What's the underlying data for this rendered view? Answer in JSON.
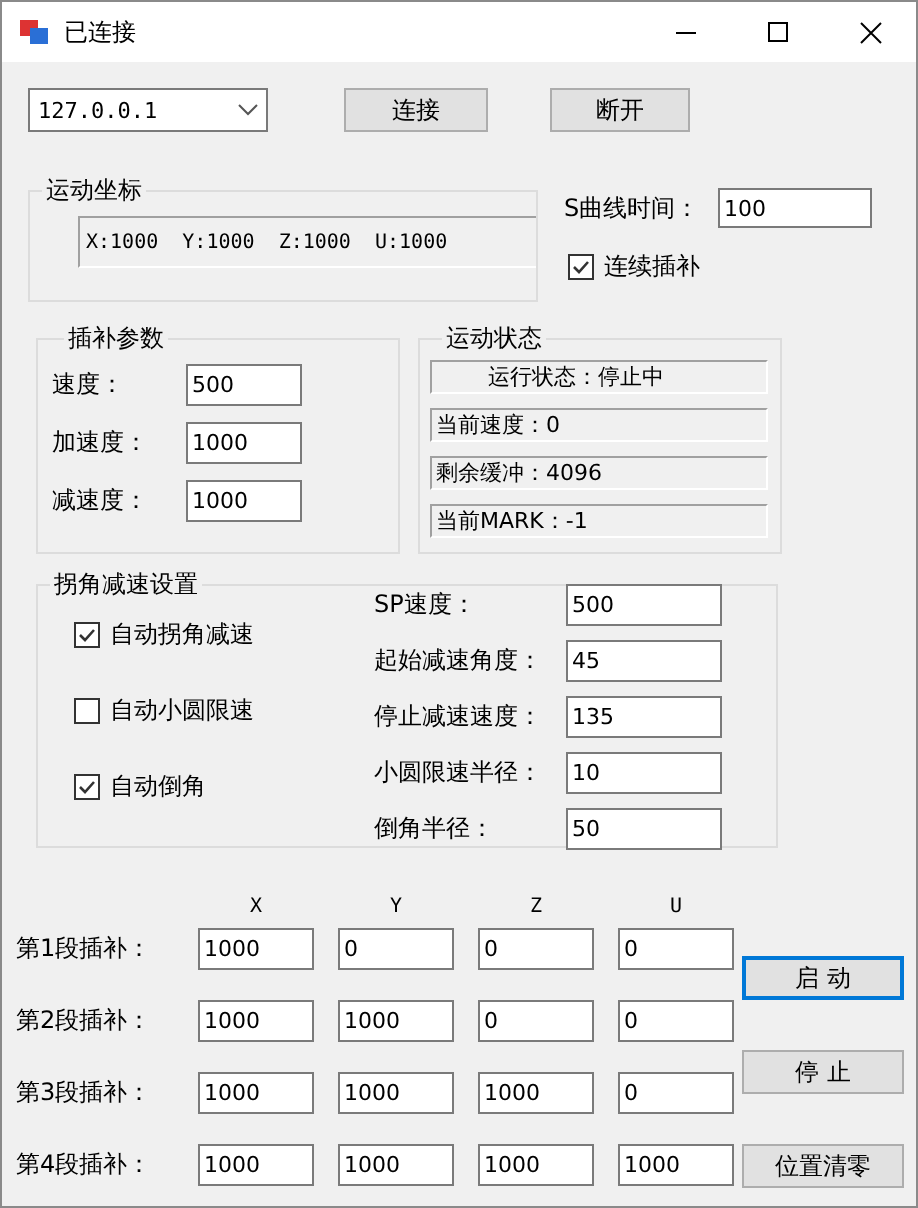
{
  "window": {
    "title": "已连接"
  },
  "connection": {
    "address": "127.0.0.1",
    "buttons": [
      "连接",
      "断开"
    ]
  },
  "coordinates": {
    "title": "运动坐标",
    "readout": "X:1000  Y:1000  Z:1000  U:1000"
  },
  "s_curve": {
    "label": "S曲线时间：",
    "value": "100"
  },
  "continuous": {
    "label": "连续插补",
    "checked": true
  },
  "interp_params": {
    "title": "插补参数",
    "fields": [
      {
        "label": "速度：",
        "value": "500"
      },
      {
        "label": "加速度：",
        "value": "1000"
      },
      {
        "label": "减速度：",
        "value": "1000"
      }
    ]
  },
  "motion_status": {
    "title": "运动状态",
    "lines": [
      "运行状态：停止中",
      "当前速度：0",
      "剩余缓冲：4096",
      "当前MARK：-1"
    ]
  },
  "corner": {
    "title": "拐角减速设置",
    "options": [
      {
        "label": "自动拐角减速",
        "checked": true
      },
      {
        "label": "自动小圆限速",
        "checked": false
      },
      {
        "label": "自动倒角",
        "checked": true
      }
    ],
    "fields": [
      {
        "label": "SP速度：",
        "value": "500"
      },
      {
        "label": "起始减速角度：",
        "value": "45"
      },
      {
        "label": "停止减速速度：",
        "value": "135"
      },
      {
        "label": "小圆限速半径：",
        "value": "10"
      },
      {
        "label": "倒角半径：",
        "value": "50"
      }
    ]
  },
  "segments": {
    "columns": [
      "X",
      "Y",
      "Z",
      "U"
    ],
    "rows": [
      {
        "label": "第1段插补：",
        "values": [
          "1000",
          "0",
          "0",
          "0"
        ]
      },
      {
        "label": "第2段插补：",
        "values": [
          "1000",
          "1000",
          "0",
          "0"
        ]
      },
      {
        "label": "第3段插补：",
        "values": [
          "1000",
          "1000",
          "1000",
          "0"
        ]
      },
      {
        "label": "第4段插补：",
        "values": [
          "1000",
          "1000",
          "1000",
          "1000"
        ]
      }
    ]
  },
  "actions": [
    {
      "label": "启  动",
      "focused": true
    },
    {
      "label": "停  止",
      "focused": false
    },
    {
      "label": "位置清零",
      "focused": false
    }
  ]
}
